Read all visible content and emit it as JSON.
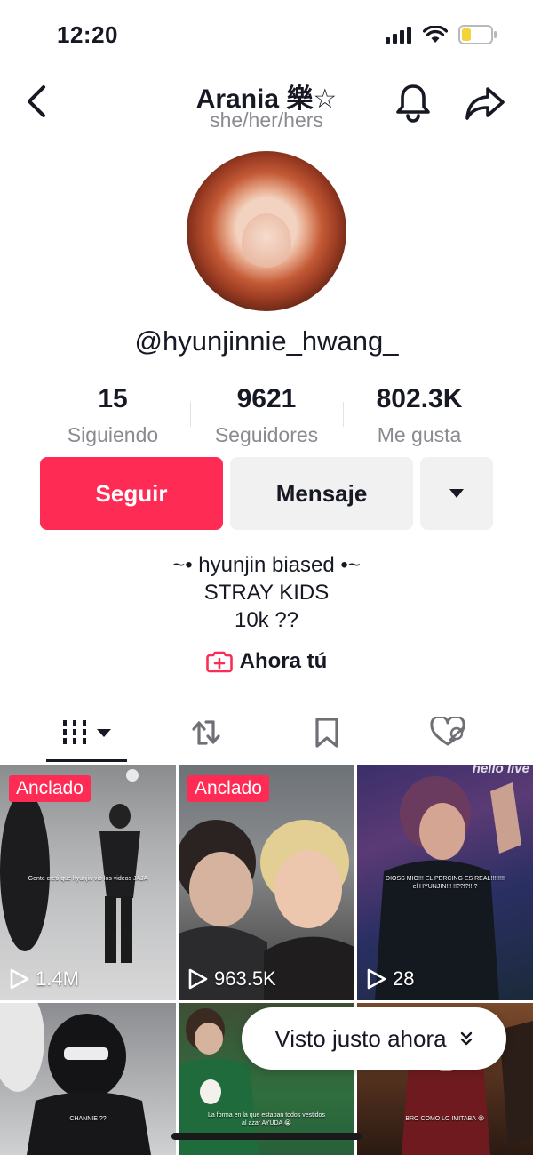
{
  "status_bar": {
    "time": "12:20"
  },
  "header": {
    "title": "Arania 樂☆",
    "pronouns": "she/her/hers"
  },
  "profile": {
    "username": "@hyunjinnie_hwang_",
    "stats": [
      {
        "value": "15",
        "label": "Siguiendo"
      },
      {
        "value": "9621",
        "label": "Seguidores"
      },
      {
        "value": "802.3K",
        "label": "Me gusta"
      }
    ],
    "buttons": {
      "follow": "Seguir",
      "message": "Mensaje"
    },
    "bio_lines": [
      "~• hyunjin biased •~",
      "STRAY KIDS",
      "10k ??"
    ],
    "now_link": "Ahora tú"
  },
  "tabs": [
    "videos-icon",
    "repost-icon",
    "bookmark-icon",
    "liked-icon"
  ],
  "videos": [
    {
      "pinned_label": "Anclado",
      "views": "1.4M",
      "caption": "Gente creó que hyunjin vio los videos JAJA"
    },
    {
      "pinned_label": "Anclado",
      "views": "963.5K",
      "caption": ""
    },
    {
      "pinned_label": "",
      "views": "28",
      "caption": "DIOSS MIO!!! EL PERCING ES REAL!!!!!!!! el HYUNJIN!!! !!??!?!!!?"
    },
    {
      "pinned_label": "",
      "views": "",
      "caption": "CHANNIE ??"
    },
    {
      "pinned_label": "",
      "views": "",
      "caption": "La forma en la que estaban todos vestidos al azar AYUDA 😭"
    },
    {
      "pinned_label": "",
      "views": "",
      "caption": "BRO COMO LO IMITABA 😭"
    }
  ],
  "video_watermark": "hello live",
  "seen_pill": {
    "label": "Visto justo ahora"
  },
  "colors": {
    "accent": "#fe2c55",
    "secondary_button": "#f1f1f2",
    "muted_text": "#8a8b91"
  }
}
